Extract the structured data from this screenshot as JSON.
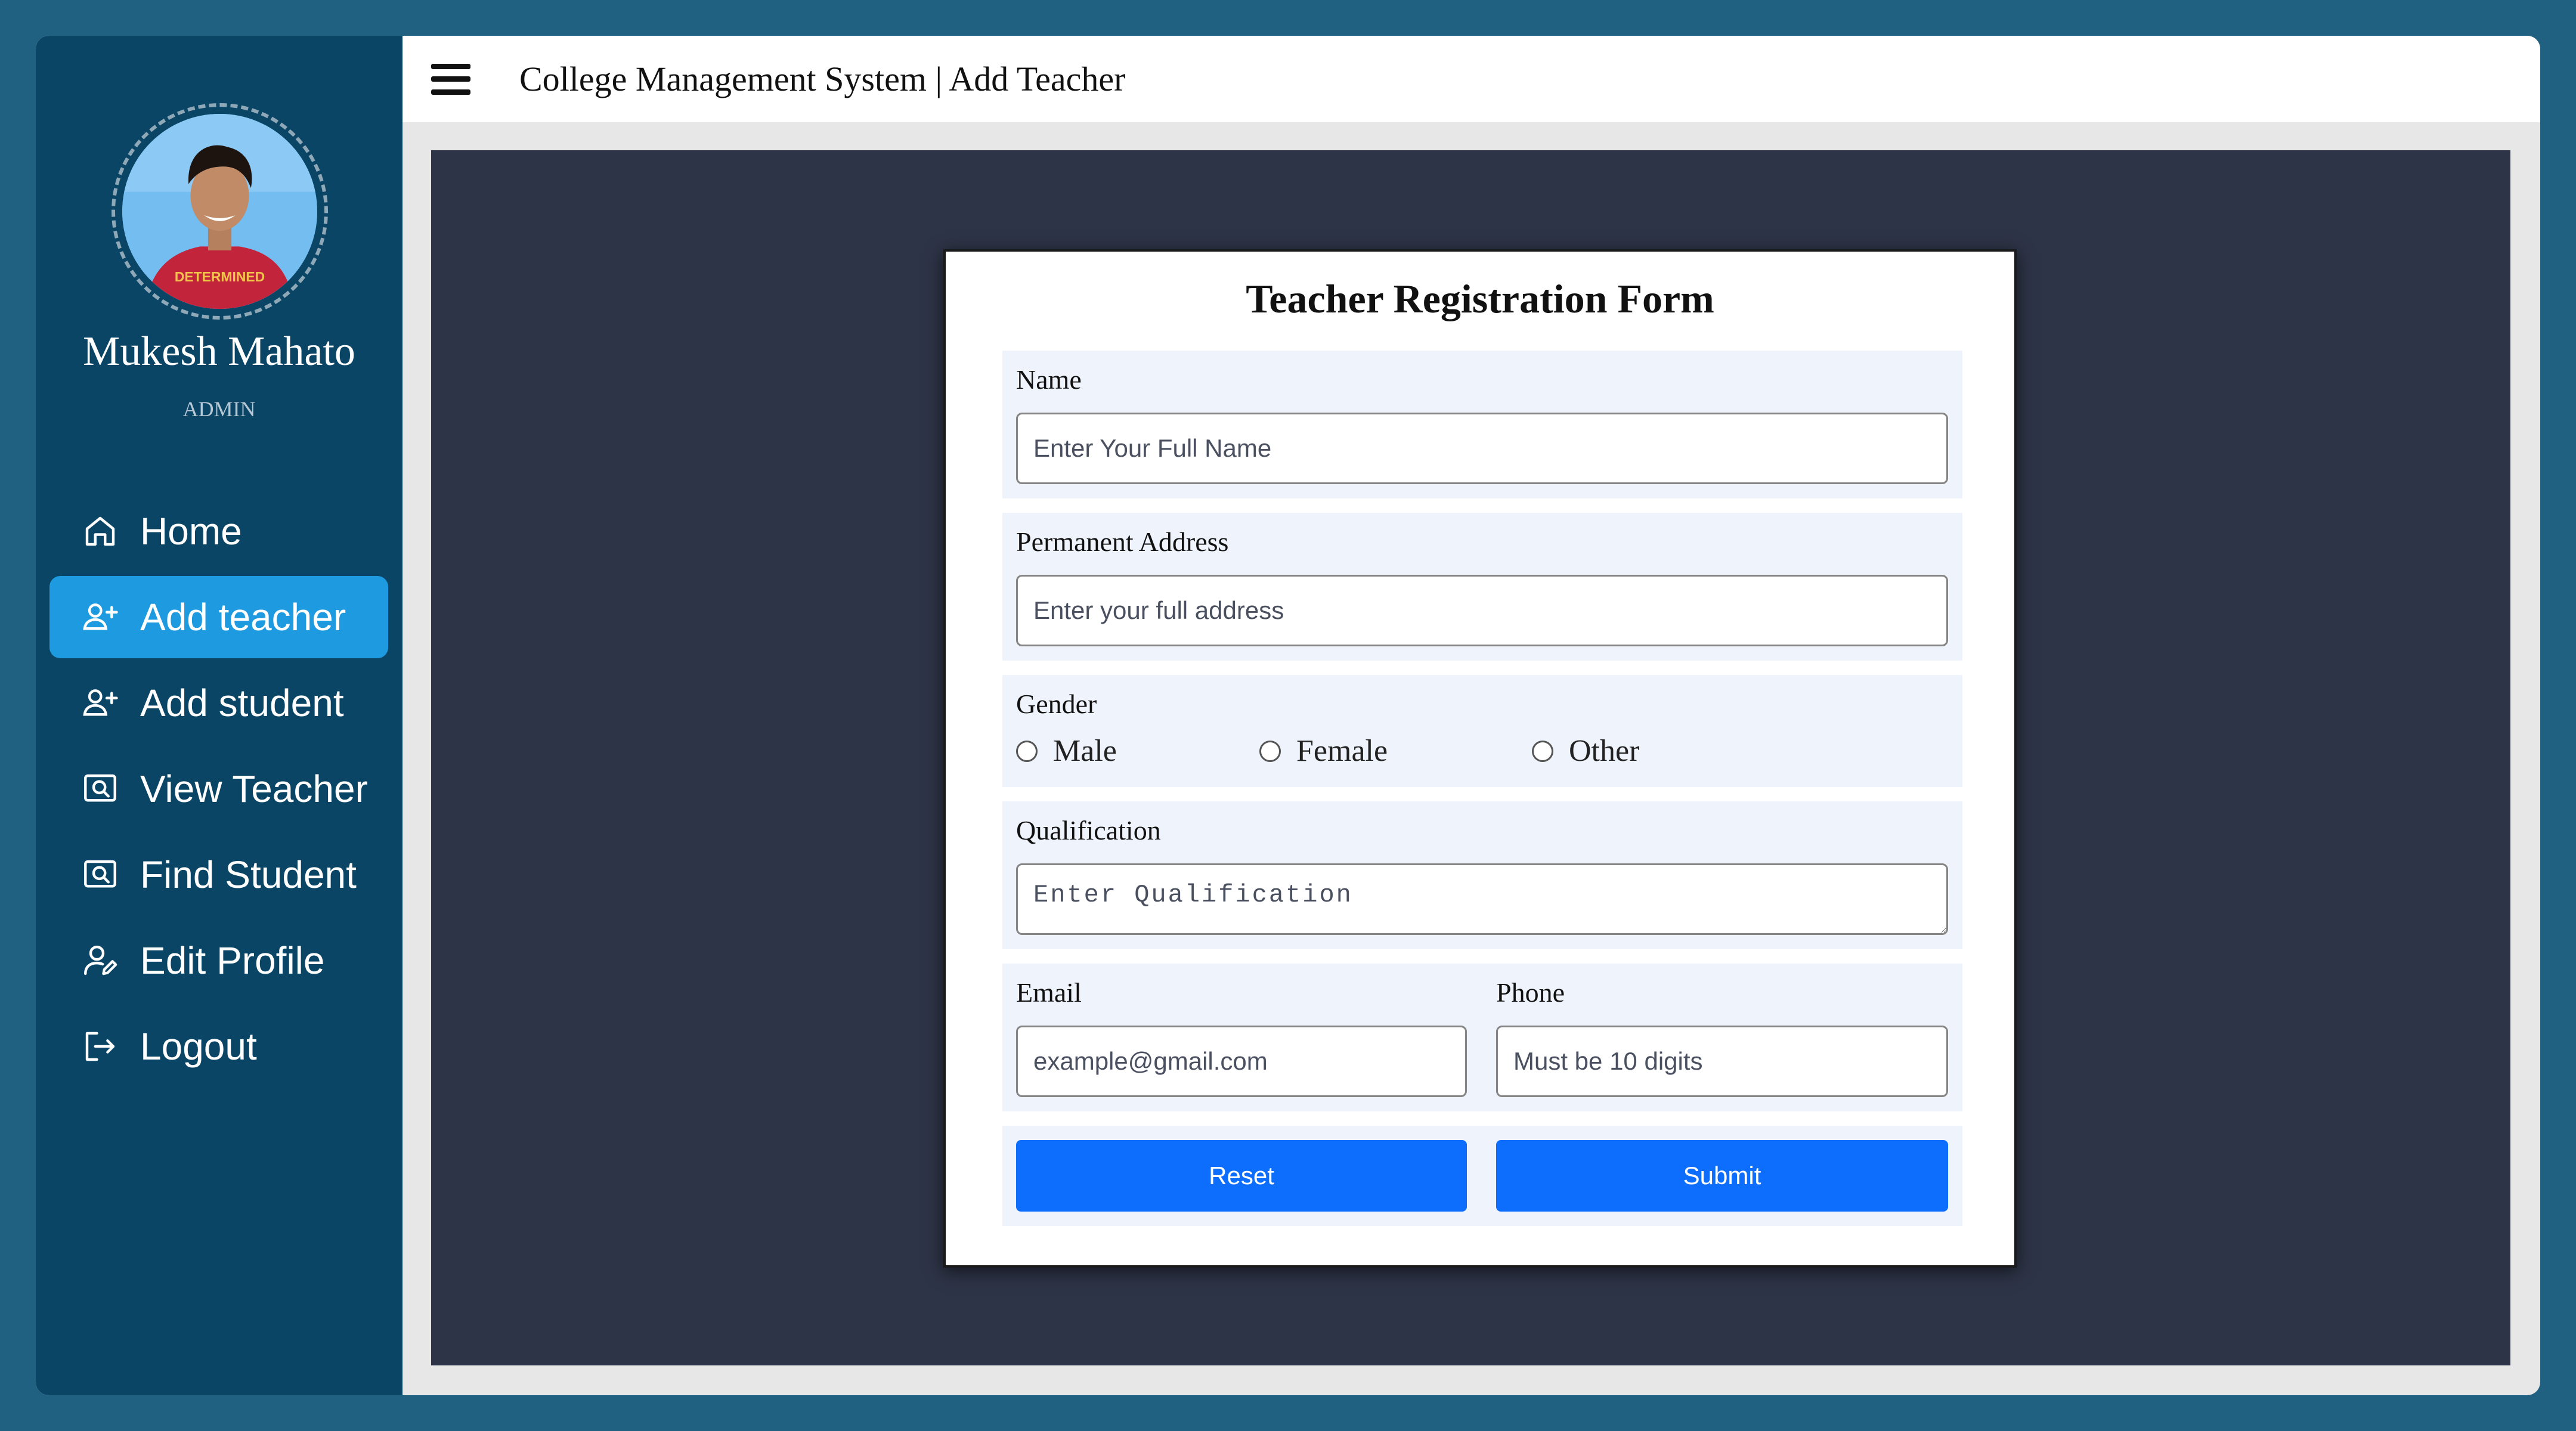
{
  "header": {
    "title": "College Management System | Add Teacher"
  },
  "profile": {
    "name": "Mukesh Mahato",
    "role": "ADMIN",
    "shirt_text": "DETERMINED"
  },
  "sidebar": {
    "items": [
      {
        "label": "Home",
        "icon": "home-icon"
      },
      {
        "label": "Add teacher",
        "icon": "user-plus-icon",
        "active": true
      },
      {
        "label": "Add student",
        "icon": "user-plus-icon"
      },
      {
        "label": "View Teacher",
        "icon": "search-box-icon"
      },
      {
        "label": "Find Student",
        "icon": "search-box-icon"
      },
      {
        "label": "Edit Profile",
        "icon": "user-edit-icon"
      },
      {
        "label": "Logout",
        "icon": "logout-icon"
      }
    ]
  },
  "form": {
    "title": "Teacher Registration Form",
    "name": {
      "label": "Name",
      "placeholder": "Enter Your Full Name",
      "value": ""
    },
    "address": {
      "label": "Permanent Address",
      "placeholder": "Enter your full address",
      "value": ""
    },
    "gender": {
      "label": "Gender",
      "options": [
        "Male",
        "Female",
        "Other"
      ],
      "selected": null
    },
    "qualification": {
      "label": "Qualification",
      "placeholder": "Enter Qualification",
      "value": ""
    },
    "email": {
      "label": "Email",
      "placeholder": "example@gmail.com",
      "value": ""
    },
    "phone": {
      "label": "Phone",
      "placeholder": "Must be 10 digits",
      "value": ""
    },
    "reset_label": "Reset",
    "submit_label": "Submit"
  },
  "colors": {
    "page_background": "#206080",
    "sidebar": "#0a4566",
    "active_nav": "#1e9be0",
    "content_background": "#2e3447",
    "form_section": "#eef3fc",
    "button": "#0d6efd"
  }
}
